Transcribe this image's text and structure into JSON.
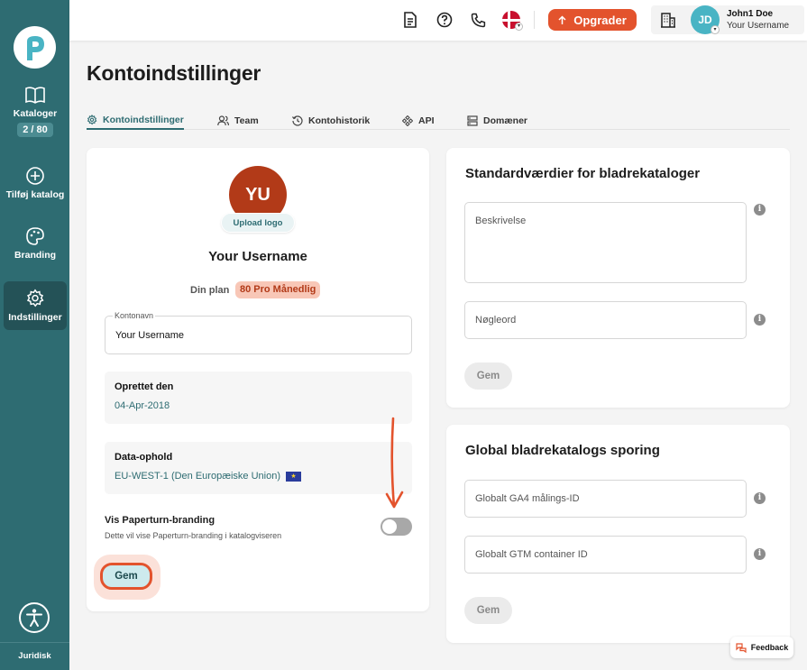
{
  "sidebar": {
    "items": [
      {
        "label": "Kataloger",
        "icon": "book-open-icon",
        "counter": "2 / 80"
      },
      {
        "label": "Tilføj katalog",
        "icon": "plus-circle-icon"
      },
      {
        "label": "Branding",
        "icon": "palette-icon"
      },
      {
        "label": "Indstillinger",
        "icon": "gear-icon",
        "active": true
      }
    ],
    "footer_label": "Juridisk"
  },
  "header": {
    "upgrade_label": "Opgrader",
    "user": {
      "initials": "JD",
      "name": "John1 Doe",
      "subtitle": "Your Username"
    }
  },
  "page": {
    "title": "Kontoindstillinger",
    "tabs": [
      {
        "label": "Kontoindstillinger",
        "active": true
      },
      {
        "label": "Team"
      },
      {
        "label": "Kontohistorik"
      },
      {
        "label": "API"
      },
      {
        "label": "Domæner"
      }
    ]
  },
  "account_card": {
    "avatar_initials": "YU",
    "upload_label": "Upload logo",
    "username": "Your Username",
    "plan_label": "Din plan",
    "plan_value": "80 Pro Månedlig",
    "account_name_label": "Kontonavn",
    "account_name_value": "Your Username",
    "created_label": "Oprettet den",
    "created_value": "04-Apr-2018",
    "residency_label": "Data-ophold",
    "residency_value": "EU-WEST-1 (Den Europæiske Union)",
    "branding_title": "Vis Paperturn-branding",
    "branding_desc": "Dette vil vise Paperturn-branding i katalogviseren",
    "branding_enabled": false,
    "save_label": "Gem"
  },
  "defaults_card": {
    "title": "Standardværdier for bladrekataloger",
    "description_placeholder": "Beskrivelse",
    "keywords_placeholder": "Nøgleord",
    "save_label": "Gem"
  },
  "tracking_card": {
    "title": "Global bladrekatalogs sporing",
    "ga4_placeholder": "Globalt GA4 målings-ID",
    "gtm_placeholder": "Globalt GTM container ID",
    "save_label": "Gem"
  },
  "feedback_label": "Feedback",
  "colors": {
    "sidebar": "#2e6c72",
    "accent": "#e3532d",
    "avatar_user": "#49b4c4",
    "avatar_account": "#b23a18"
  }
}
